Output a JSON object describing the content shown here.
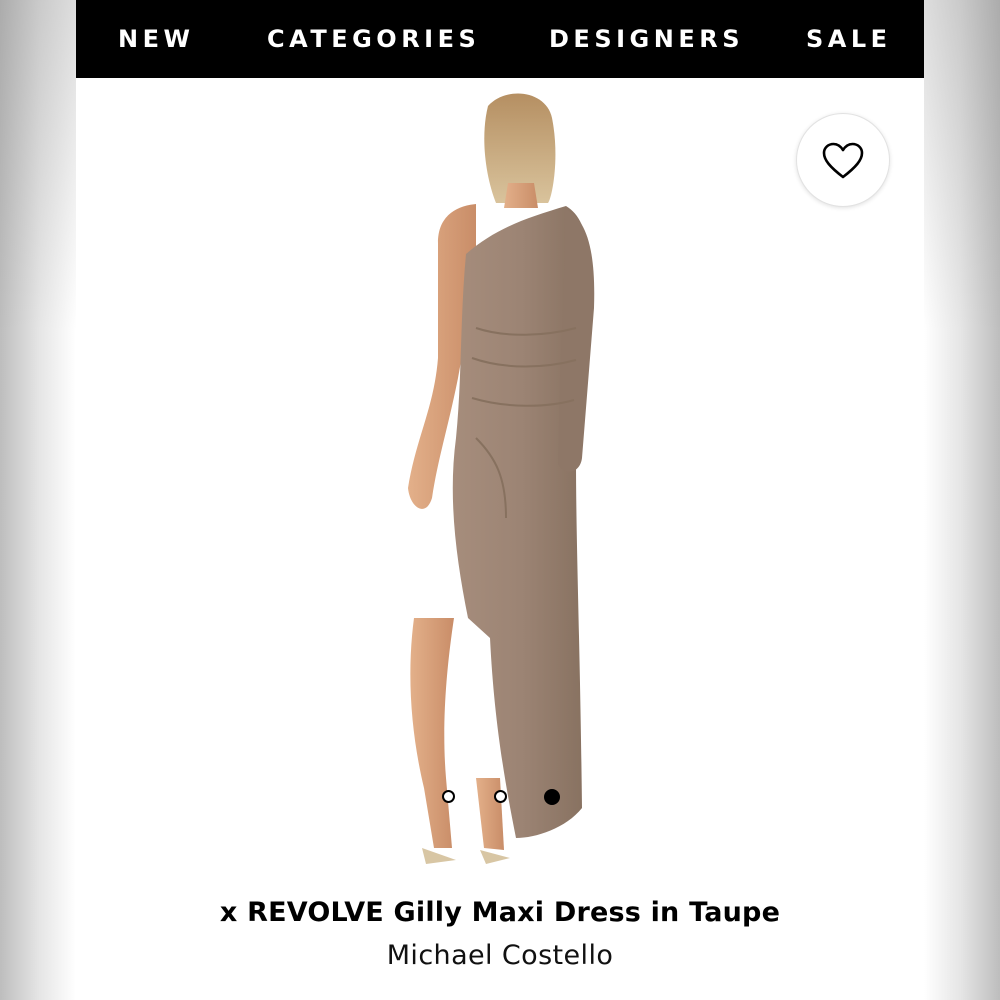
{
  "nav": {
    "items": [
      {
        "label": "NEW"
      },
      {
        "label": "CATEGORIES"
      },
      {
        "label": "DESIGNERS"
      },
      {
        "label": "SALE"
      }
    ]
  },
  "favorite": {
    "icon": "heart-outline-icon"
  },
  "gallery": {
    "dots": [
      {
        "active": false
      },
      {
        "active": false
      },
      {
        "active": true
      }
    ]
  },
  "product": {
    "title": "x REVOLVE Gilly Maxi Dress in Taupe",
    "brand": "Michael Costello",
    "dress_color": "#9c8474"
  }
}
